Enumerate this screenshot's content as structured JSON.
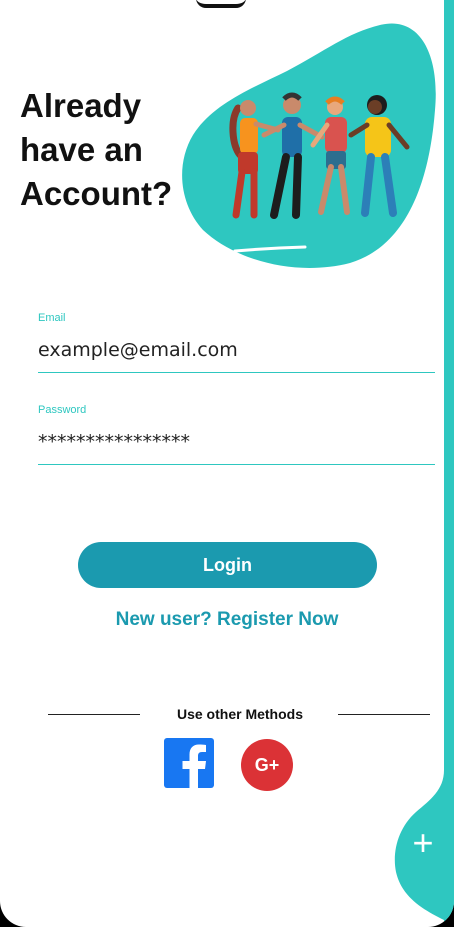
{
  "hero": {
    "title_line1": "Already",
    "title_line2": "have an",
    "title_line3": "Account?"
  },
  "form": {
    "email_label": "Email",
    "email_value": "example@email.com",
    "password_label": "Password",
    "password_value": "****************"
  },
  "actions": {
    "login_label": "Login",
    "register_label": "New user? Register Now"
  },
  "social": {
    "heading": "Use other Methods",
    "facebook_icon": "facebook-icon",
    "google_plus_icon": "google-plus-icon",
    "google_plus_text": "G+"
  },
  "fab": {
    "icon": "plus-icon",
    "symbol": "+"
  },
  "colors": {
    "accent": "#2ec7c0",
    "button": "#1b9aaf",
    "facebook": "#1877f2",
    "google": "#db3236"
  }
}
